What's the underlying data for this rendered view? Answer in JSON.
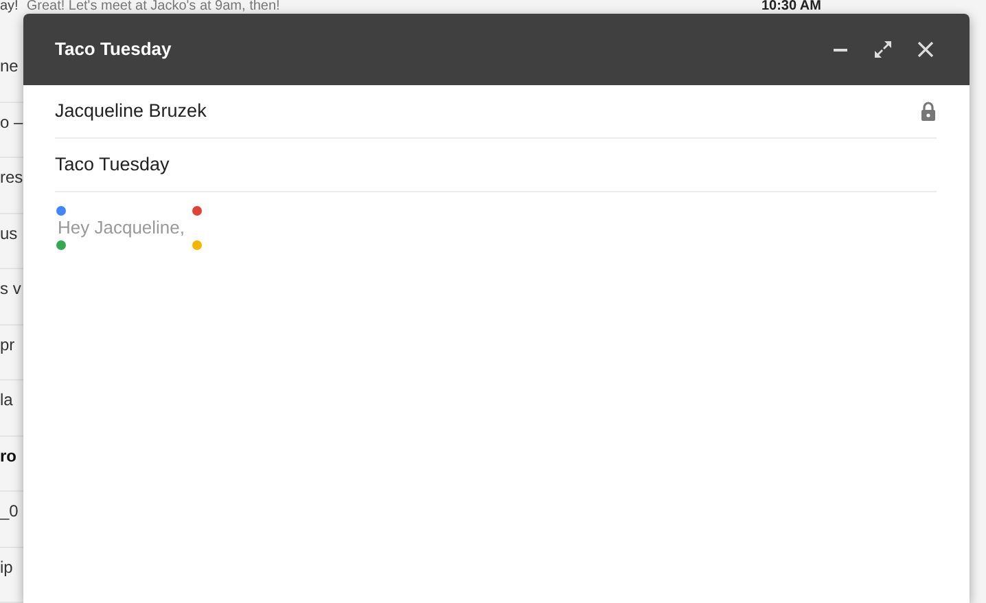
{
  "inbox_behind": {
    "top_row": {
      "sender": "ay!",
      "snippet": "Great! Let's meet at Jacko's at 9am, then!",
      "time": "10:30 AM"
    },
    "row_fragments": [
      {
        "text": "ne",
        "unread": false
      },
      {
        "text": "o –",
        "unread": false
      },
      {
        "text": "res",
        "unread": false
      },
      {
        "text": "us",
        "unread": false
      },
      {
        "text": "s v",
        "unread": false
      },
      {
        "text": "pr",
        "unread": false
      },
      {
        "text": "la",
        "unread": false
      },
      {
        "text": "ro",
        "unread": true
      },
      {
        "text": "_0",
        "unread": false
      },
      {
        "text": "ip",
        "unread": false
      }
    ]
  },
  "compose": {
    "title": "Taco Tuesday",
    "to": "Jacqueline Bruzek",
    "subject": "Taco Tuesday",
    "body": "Hey Jacqueline,",
    "selection_handles": [
      {
        "color": "#4285f4"
      },
      {
        "color": "#db4437"
      },
      {
        "color": "#34a853"
      },
      {
        "color": "#f4b400"
      }
    ]
  }
}
